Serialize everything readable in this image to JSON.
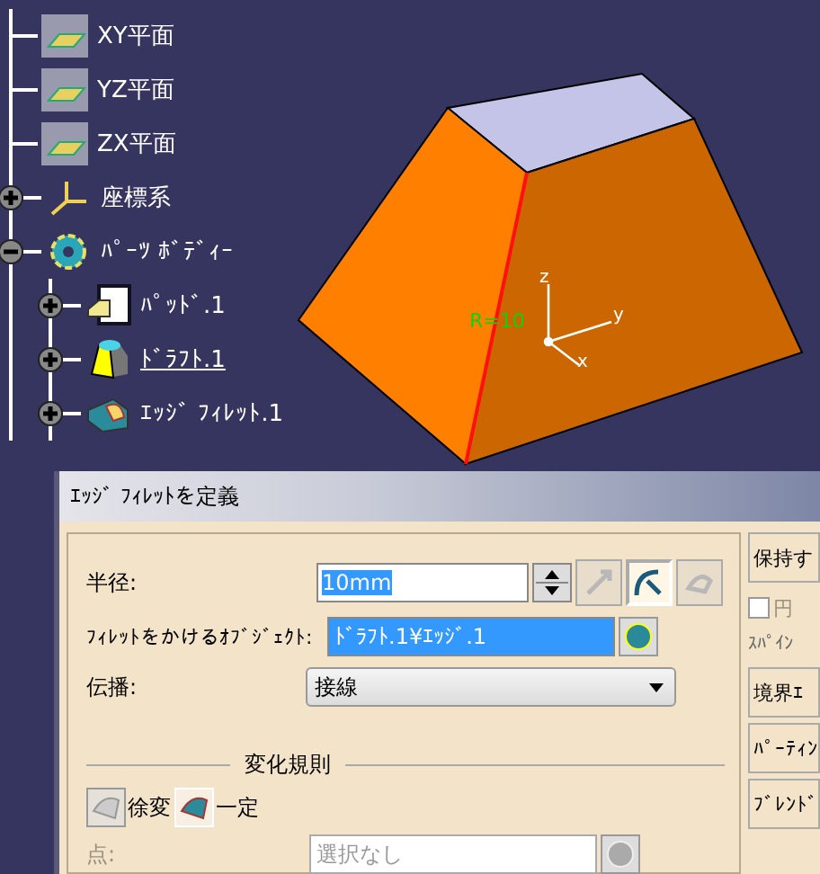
{
  "tree": [
    {
      "kind": "plane",
      "label": "XY平面"
    },
    {
      "kind": "plane",
      "label": "YZ平面"
    },
    {
      "kind": "plane",
      "label": "ZX平面"
    },
    {
      "kind": "axis",
      "label": "座標系",
      "expanded": false
    },
    {
      "kind": "body",
      "label": "ﾊﾟｰﾂ ﾎﾞﾃﾞｨｰ",
      "expanded": true,
      "children": [
        {
          "kind": "pad",
          "label": "ﾊﾟｯﾄﾞ.1",
          "expanded": false,
          "current": false
        },
        {
          "kind": "draft",
          "label": "ﾄﾞﾗﾌﾄ.1",
          "expanded": false,
          "current": true
        },
        {
          "kind": "fillet",
          "label": "ｴｯｼﾞ ﾌｨﾚｯﾄ.1",
          "expanded": false,
          "current": false
        }
      ]
    }
  ],
  "viewport": {
    "dimension_label": "R=10",
    "axis_labels": [
      "z",
      "y",
      "x"
    ]
  },
  "dialog": {
    "title": "ｴｯｼﾞ ﾌｨﾚｯﾄを定義",
    "radius": {
      "label": "半径:",
      "value": "10mm"
    },
    "mode_buttons": [
      {
        "selected": false,
        "disabled": true
      },
      {
        "selected": true,
        "disabled": false
      },
      {
        "selected": false,
        "disabled": true
      }
    ],
    "object": {
      "label": "ﾌｨﾚｯﾄをかけるｵﾌﾞｼﾞｪｸﾄ:",
      "value": "ﾄﾞﾗﾌﾄ.1¥ｴｯｼﾞ.1"
    },
    "propagation": {
      "label": "伝播:",
      "value": "接線"
    },
    "law": {
      "title": "変化規則",
      "options": [
        {
          "label": "徐変",
          "selected": false
        },
        {
          "label": "一定",
          "selected": true
        }
      ]
    },
    "point": {
      "label": "点:",
      "placeholder": "選択なし",
      "disabled": true
    },
    "side": [
      {
        "kind": "button",
        "label": "保持す"
      },
      {
        "kind": "checkbox",
        "label": "円",
        "checked": false
      },
      {
        "kind": "text",
        "label": "ｽﾊﾟｲﾝ"
      },
      {
        "kind": "button",
        "label": "境界ｴ"
      },
      {
        "kind": "button",
        "label": "ﾊﾟｰﾃｨﾝ"
      },
      {
        "kind": "button",
        "label": "ﾌﾞﾚﾝﾄﾞ"
      }
    ]
  }
}
